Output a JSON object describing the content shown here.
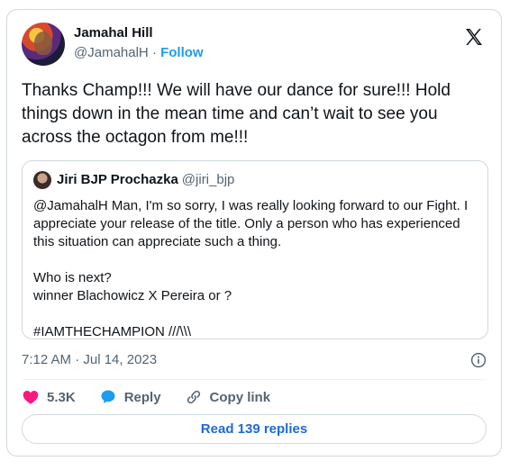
{
  "author": {
    "name": "Jamahal Hill",
    "handle": "@JamahalH",
    "separator": "·",
    "follow_label": "Follow"
  },
  "tweet": {
    "text": "Thanks Champ!!! We will have our dance for sure!!! Hold things down in the mean time and can’t wait to see you across the octagon from me!!!"
  },
  "quoted_tweet": {
    "name": "Jiri BJP Prochazka",
    "handle": "@jiri_bjp",
    "text": "@JamahalH Man, I'm so sorry, I was really looking forward to our Fight. I appreciate your release of the title. Only a person who has experienced this situation can appreciate such a thing.\n\nWho is next?\nwinner Blachowicz X Pereira or ?\n\n#IAMTHECHAMPION ///\\\\\\"
  },
  "meta": {
    "timestamp": "7:12 AM · Jul 14, 2023"
  },
  "actions": {
    "like_count": "5.3K",
    "reply_label": "Reply",
    "copy_link_label": "Copy link"
  },
  "read_replies_label": "Read 139 replies",
  "colors": {
    "accent": "#1d9bf0",
    "like": "#f91880",
    "reply_icon": "#1d9bf0",
    "text_secondary": "#536471"
  },
  "icons": {
    "brand": "x-logo-icon",
    "info": "info-icon",
    "like": "heart-icon",
    "reply": "speech-bubble-icon",
    "copy": "link-icon"
  }
}
